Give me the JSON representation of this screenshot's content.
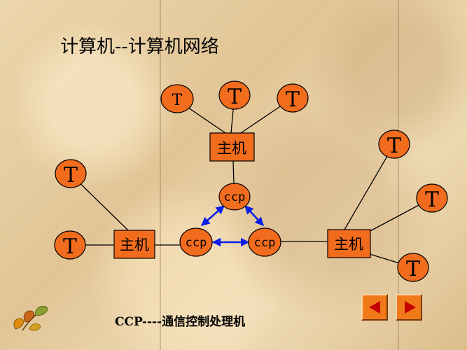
{
  "title": "计算机--计算机网络",
  "caption": "CCP----通信控制处理机",
  "nodes": {
    "host_top": "主机",
    "host_left": "主机",
    "host_right": "主机",
    "ccp_top": "ccp",
    "ccp_left": "ccp",
    "ccp_right": "ccp",
    "terminal": "T"
  },
  "colors": {
    "node_fill": "#f26c1d",
    "line": "#000000",
    "arrow": "#0a1fe8",
    "background": "#e9d3a8"
  },
  "nav": {
    "prev_icon": "triangle-left-icon",
    "next_icon": "triangle-right-icon"
  },
  "decoration": {
    "logo_icon": "autumn-leaves-icon"
  }
}
